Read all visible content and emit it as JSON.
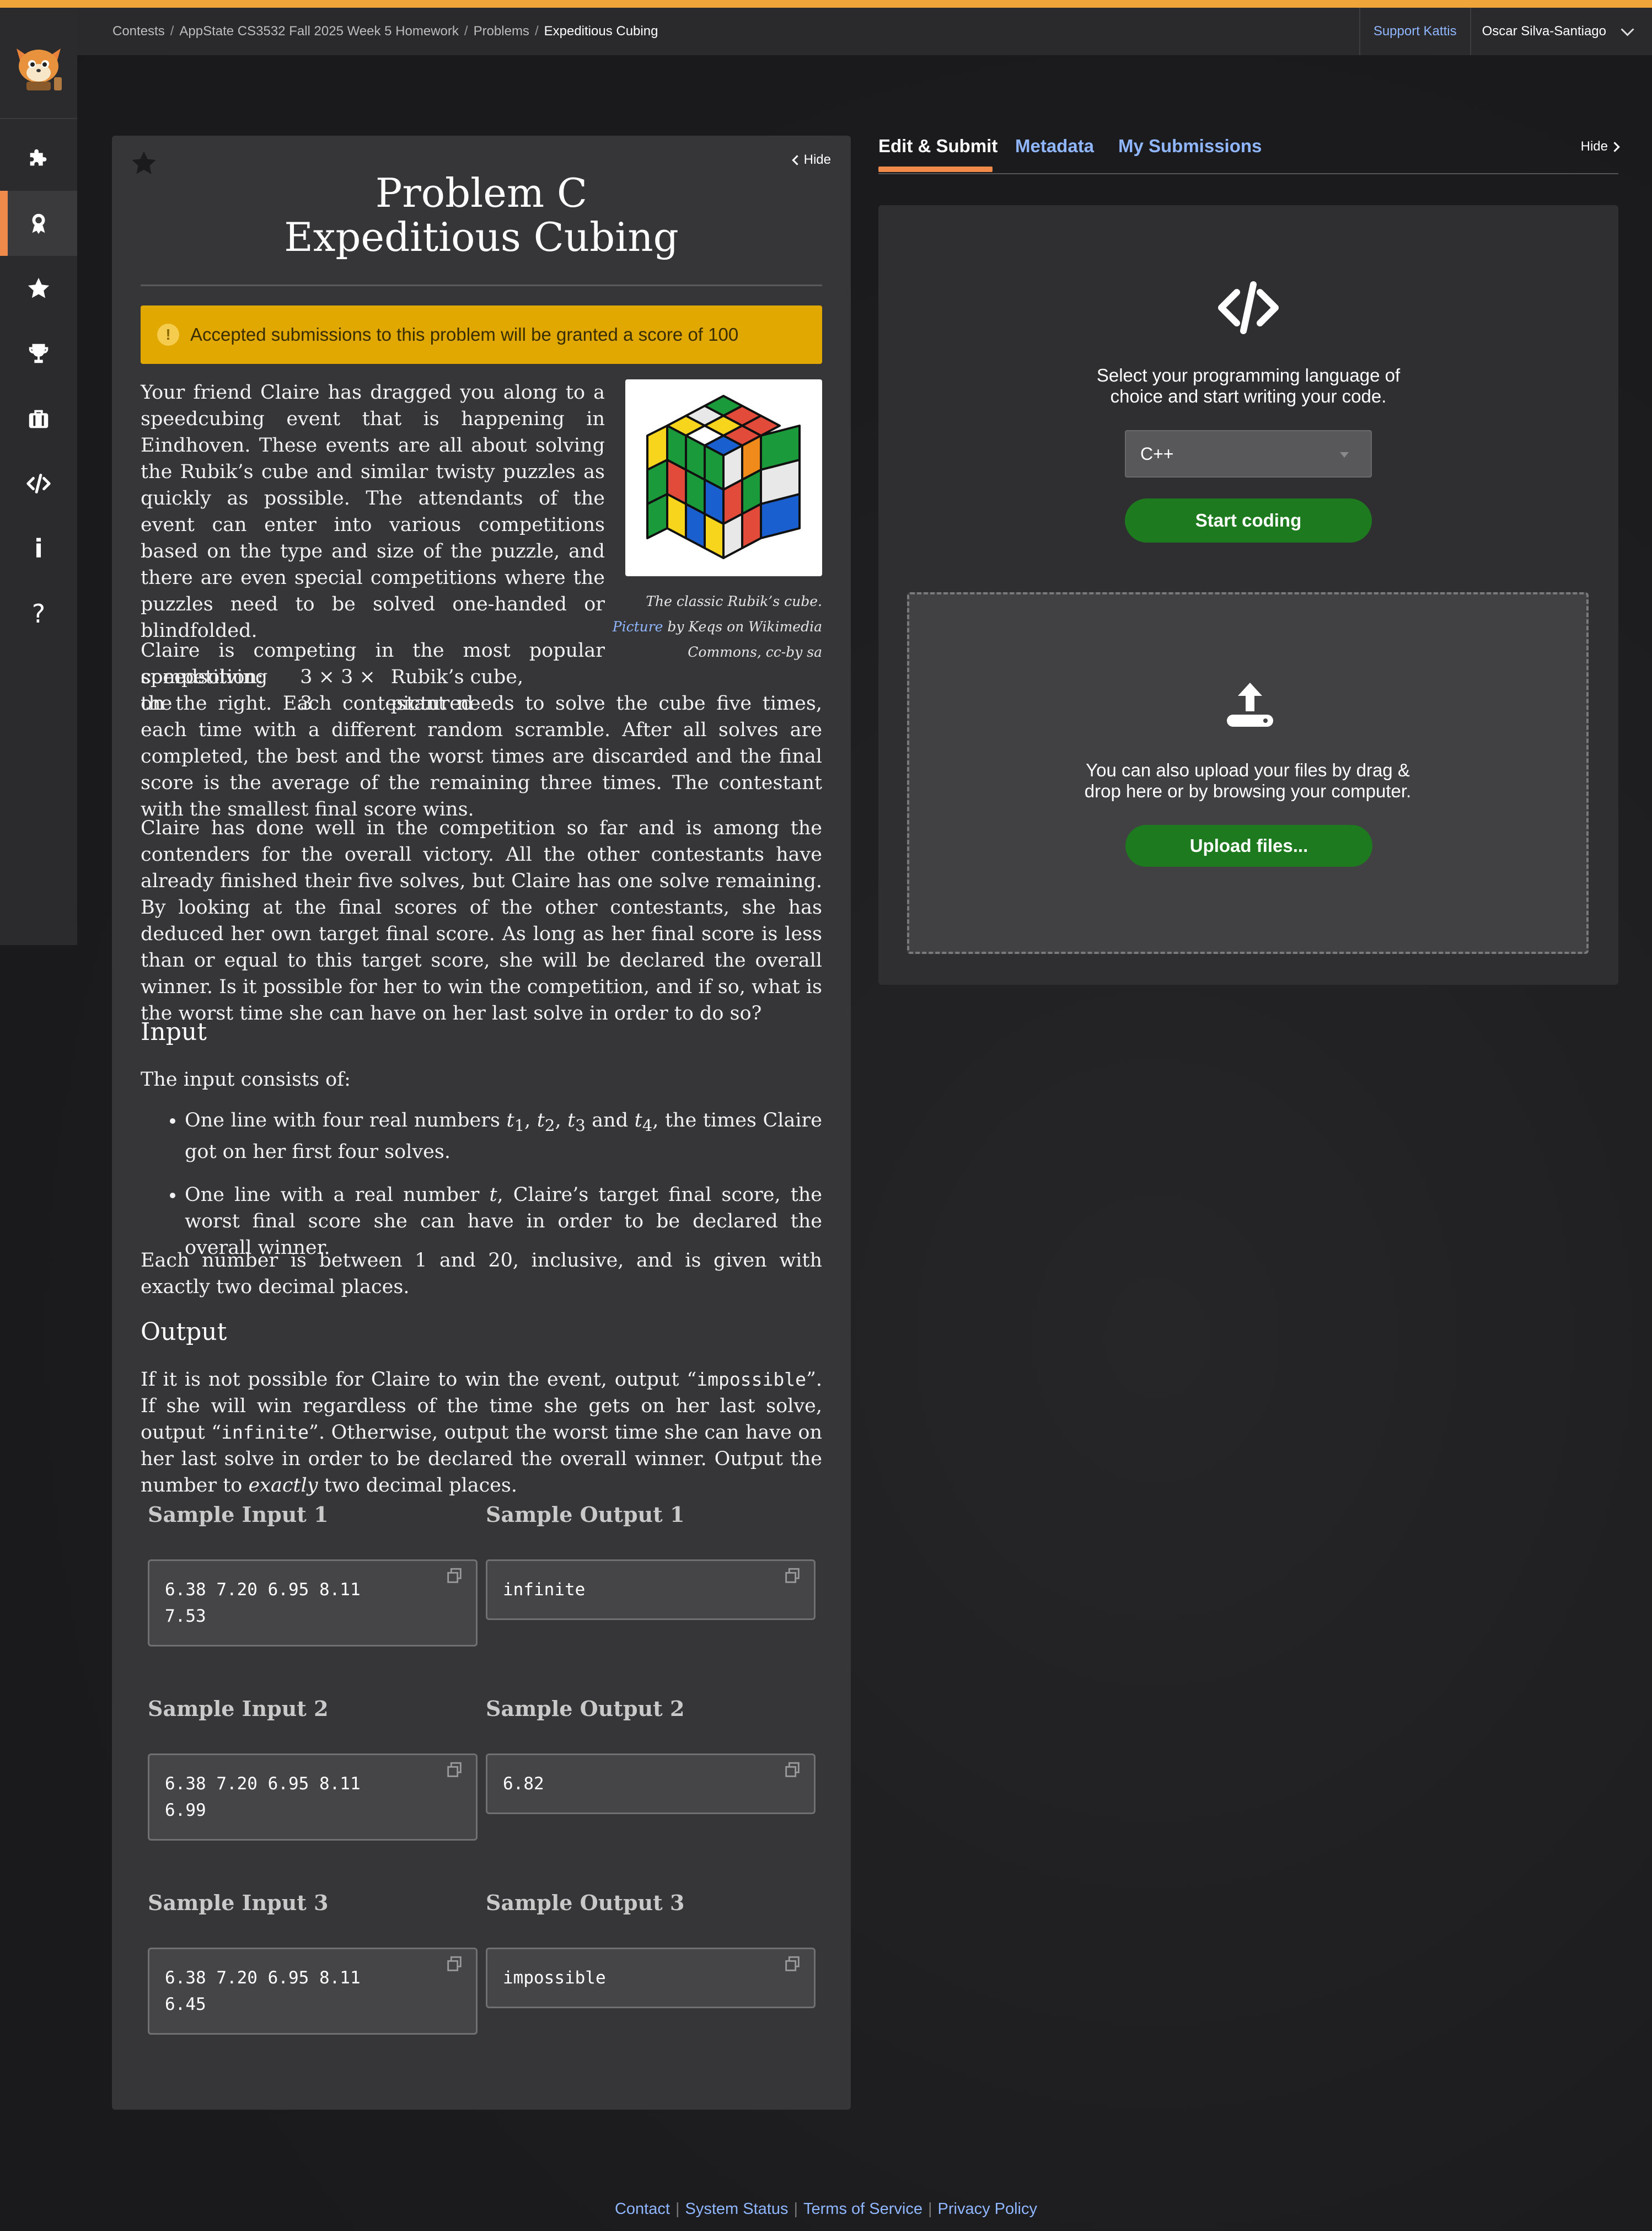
{
  "header": {
    "breadcrumbs": [
      "Contests",
      "AppState CS3532 Fall 2025 Week 5 Homework",
      "Problems",
      "Expeditious Cubing"
    ],
    "support_link": "Support Kattis",
    "user_name": "Oscar Silva-Santiago"
  },
  "sidebar": {
    "items": [
      {
        "icon": "puzzle-icon"
      },
      {
        "icon": "badge-icon",
        "active": true
      },
      {
        "icon": "star-icon"
      },
      {
        "icon": "trophy-icon"
      },
      {
        "icon": "briefcase-icon"
      },
      {
        "icon": "code-icon",
        "glyph": "</>"
      },
      {
        "icon": "info-icon",
        "glyph": "i"
      },
      {
        "icon": "help-icon",
        "glyph": "?"
      }
    ]
  },
  "problem": {
    "hide_label": "Hide",
    "title_line1": "Problem C",
    "title_line2": "Expeditious Cubing",
    "banner": "Accepted submissions to this problem will be granted a score of 100",
    "paragraphs": {
      "p1": "Your friend Claire has dragged you along to a speedcubing event that is happening in Eindhoven. These events are all about solving the Rubik’s cube and similar twisty puzzles as quickly as possible. The attendants of the event can enter into various competitions based on the type and size of the puzzle, and there are even special competitions where the puzzles need to be solved one-handed or blindfolded.",
      "p2a": "Claire is competing in the most popular competition:",
      "p2b_pre": "speedsolving the",
      "p2b_math": "3 × 3 × 3",
      "p2b_post": "Rubik’s cube, pictured",
      "p2c": "on the right. Each contestant needs to solve the cube five times, each time with a different random scramble. After all solves are completed, the best and the worst times are discarded and the final score is the average of the remaining three times. The contestant with the smallest final score wins.",
      "p3": "Claire has done well in the competition so far and is among the contenders for the overall victory. All the other contestants have already finished their five solves, but Claire has one solve remaining. By looking at the final scores of the other contestants, she has deduced her own target final score. As long as her final score is less than or equal to this target score, she will be declared the overall winner. Is it possible for her to win the competition, and if so, what is the worst time she can have on her last solve in order to do so?"
    },
    "figure": {
      "caption1": "The classic Rubik’s cube.",
      "caption_link": "Picture",
      "caption2": " by Keqs on Wikimedia",
      "caption3": "Commons, cc-by sa"
    },
    "input_heading": "Input",
    "input_intro": "The input consists of:",
    "input_bullet1_a": "One line with four real numbers ",
    "input_bullet1_b": ", the times Claire got on her first four solves.",
    "input_bullet2_a": "One line with a real number ",
    "input_bullet2_b": ", Claire’s target final score, the worst final score she can have in order to be declared the overall winner.",
    "input_constraints": "Each number is between 1 and 20, inclusive, and is given with exactly two decimal places.",
    "output_heading": "Output",
    "output_text_1": "If it is not possible for Claire to win the event, output “",
    "output_impossible": "impossible",
    "output_text_2": "”. If she will win regardless of the time she gets on her last solve, output “",
    "output_infinite": "infinite",
    "output_text_3": "”. Otherwise, output the worst time she can have on her last solve in order to be declared the overall winner. Output the number to ",
    "output_exactly": "exactly",
    "output_text_4": " two decimal places.",
    "samples": [
      {
        "in_label": "Sample Input 1",
        "out_label": "Sample Output 1",
        "input": "6.38 7.20 6.95 8.11\n7.53",
        "output": "infinite"
      },
      {
        "in_label": "Sample Input 2",
        "out_label": "Sample Output 2",
        "input": "6.38 7.20 6.95 8.11\n6.99",
        "output": "6.82"
      },
      {
        "in_label": "Sample Input 3",
        "out_label": "Sample Output 3",
        "input": "6.38 7.20 6.95 8.11\n6.45",
        "output": "impossible"
      }
    ]
  },
  "right_panel": {
    "tabs": [
      {
        "label": "Edit & Submit",
        "active": true
      },
      {
        "label": "Metadata"
      },
      {
        "label": "My Submissions"
      }
    ],
    "hide_label": "Hide",
    "select_prompt_line1": "Select your programming language of",
    "select_prompt_line2": "choice and start writing your code.",
    "language": "C++",
    "start_button": "Start coding",
    "upload_line1": "You can also upload your files by drag &",
    "upload_line2": "drop here or by browsing your computer.",
    "upload_button": "Upload files..."
  },
  "footer": {
    "links": [
      "Contact",
      "System Status",
      "Terms of Service",
      "Privacy Policy"
    ]
  },
  "colors": {
    "accent_orange": "#f08a4b",
    "top_accent": "#f0a53a",
    "banner_yellow": "#e0a800",
    "green_button": "#1e7a1e",
    "link_blue": "#8fb6ff"
  }
}
